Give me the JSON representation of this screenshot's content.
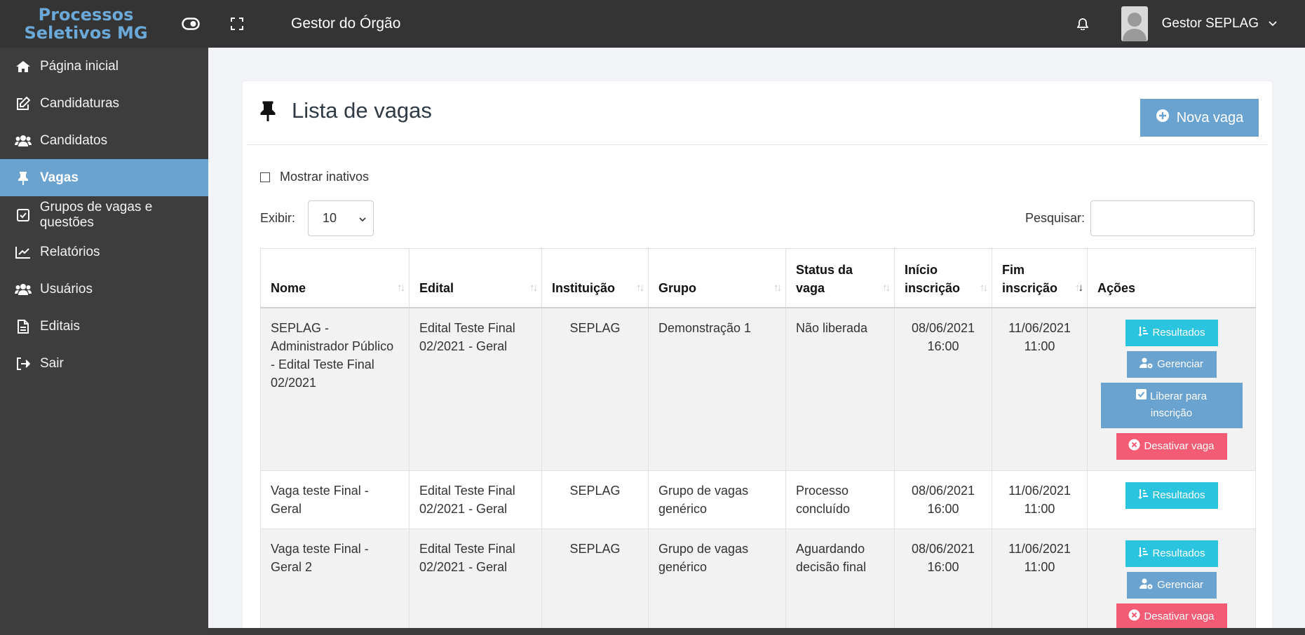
{
  "topbar": {
    "logo_line1": "Processos",
    "logo_line2": "Seletivos MG",
    "title": "Gestor do Órgão",
    "username": "Gestor SEPLAG"
  },
  "sidebar": {
    "items": [
      {
        "label": "Página inicial",
        "icon": "home-icon"
      },
      {
        "label": "Candidaturas",
        "icon": "edit-icon"
      },
      {
        "label": "Candidatos",
        "icon": "users-icon"
      },
      {
        "label": "Vagas",
        "icon": "pin-icon",
        "active": true
      },
      {
        "label": "Grupos de vagas e questões",
        "icon": "checkbox-icon"
      },
      {
        "label": "Relatórios",
        "icon": "chart-line-icon"
      },
      {
        "label": "Usuários",
        "icon": "users-icon"
      },
      {
        "label": "Editais",
        "icon": "document-icon"
      },
      {
        "label": "Sair",
        "icon": "sign-out-icon"
      }
    ]
  },
  "page": {
    "title": "Lista de vagas",
    "new_button": "Nova vaga",
    "show_inactive": "Mostrar inativos",
    "show_label": "Exibir:",
    "show_value": "10",
    "search_label": "Pesquisar:",
    "search_value": ""
  },
  "table": {
    "headers": {
      "nome": "Nome",
      "edital": "Edital",
      "instituicao": "Instituição",
      "grupo": "Grupo",
      "status_1": "Status da",
      "status_2": "vaga",
      "inicio_1": "Início",
      "inicio_2": "inscrição",
      "fim_1": "Fim",
      "fim_2": "inscrição",
      "acoes": "Ações"
    },
    "rows": [
      {
        "nome": "SEPLAG - Administrador Público - Edital Teste Final 02/2021",
        "edital": "Edital Teste Final 02/2021 - Geral",
        "instituicao": "SEPLAG",
        "grupo": "Demonstração 1",
        "status": "Não liberada",
        "inicio_data": "08/06/2021",
        "inicio_hora": "16:00",
        "fim_data": "11/06/2021",
        "fim_hora": "11:00"
      },
      {
        "nome": "Vaga teste Final - Geral",
        "edital": "Edital Teste Final 02/2021 - Geral",
        "instituicao": "SEPLAG",
        "grupo": "Grupo de vagas genérico",
        "status": "Processo concluído",
        "inicio_data": "08/06/2021",
        "inicio_hora": "16:00",
        "fim_data": "11/06/2021",
        "fim_hora": "11:00"
      },
      {
        "nome": "Vaga teste Final - Geral 2",
        "edital": "Edital Teste Final 02/2021 - Geral",
        "instituicao": "SEPLAG",
        "grupo": "Grupo de vagas genérico",
        "status": "Aguardando decisão final",
        "inicio_data": "08/06/2021",
        "inicio_hora": "16:00",
        "fim_data": "11/06/2021",
        "fim_hora": "11:00"
      }
    ],
    "actions": {
      "resultados": "Resultados",
      "gerenciar": "Gerenciar",
      "liberar_1": "Liberar para",
      "liberar_2": "inscrição",
      "desativar": "Desativar vaga"
    }
  },
  "colors": {
    "accent": "#6aa2d0",
    "info": "#2bc4e0",
    "danger": "#f35c74",
    "sidebar_bg": "#3d3d3d",
    "topbar_bg": "#343434"
  }
}
